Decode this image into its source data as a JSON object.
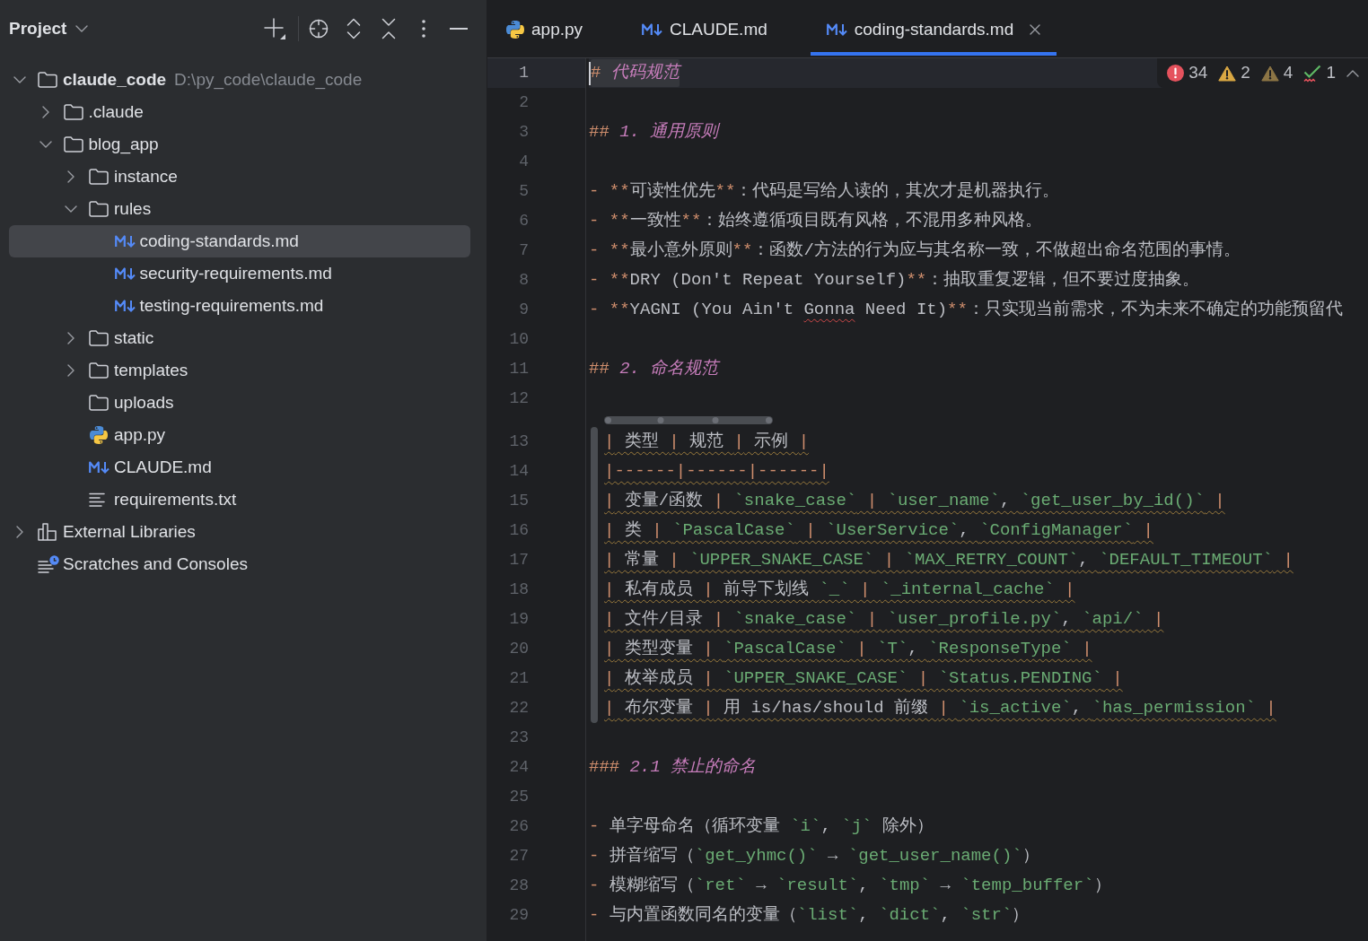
{
  "project_panel": {
    "title": "Project",
    "tree": [
      {
        "label": "claude_code",
        "kind": "folder",
        "path": "D:\\py_code\\claude_code",
        "expanded": true,
        "selected": false,
        "children": [
          {
            "label": ".claude",
            "kind": "folder",
            "expanded": false,
            "selected": false
          },
          {
            "label": "blog_app",
            "kind": "folder",
            "expanded": true,
            "selected": false,
            "children": [
              {
                "label": "instance",
                "kind": "folder",
                "expanded": false,
                "selected": false
              },
              {
                "label": "rules",
                "kind": "folder",
                "expanded": true,
                "selected": false,
                "children": [
                  {
                    "label": "coding-standards.md",
                    "kind": "markdown",
                    "selected": true
                  },
                  {
                    "label": "security-requirements.md",
                    "kind": "markdown",
                    "selected": false
                  },
                  {
                    "label": "testing-requirements.md",
                    "kind": "markdown",
                    "selected": false
                  }
                ]
              },
              {
                "label": "static",
                "kind": "folder",
                "expanded": false,
                "selected": false
              },
              {
                "label": "templates",
                "kind": "folder",
                "expanded": false,
                "selected": false
              },
              {
                "label": "uploads",
                "kind": "folder",
                "selected": false
              },
              {
                "label": "app.py",
                "kind": "python",
                "selected": false
              },
              {
                "label": "CLAUDE.md",
                "kind": "markdown",
                "selected": false
              },
              {
                "label": "requirements.txt",
                "kind": "text",
                "selected": false
              }
            ]
          }
        ]
      },
      {
        "label": "External Libraries",
        "kind": "libraries",
        "expanded": false,
        "selected": false
      },
      {
        "label": "Scratches and Consoles",
        "kind": "scratches",
        "selected": false
      }
    ]
  },
  "editor_tabs": [
    {
      "label": "app.py",
      "kind": "python",
      "selected": false
    },
    {
      "label": "CLAUDE.md",
      "kind": "markdown",
      "selected": false
    },
    {
      "label": "coding-standards.md",
      "kind": "markdown",
      "selected": true
    }
  ],
  "inspections": [
    {
      "kind": "error",
      "count": "34"
    },
    {
      "kind": "warning",
      "count": "2"
    },
    {
      "kind": "weak_warning",
      "count": "4"
    },
    {
      "kind": "typo",
      "count": "1"
    }
  ],
  "editor": {
    "lines": [
      {
        "number": "1",
        "kind": "text",
        "current": true,
        "tokens": [
          {
            "kind": "marker",
            "text": "#"
          },
          {
            "kind": "heading",
            "text": " 代码规范"
          }
        ]
      },
      {
        "number": "2",
        "kind": "text",
        "current": false
      },
      {
        "number": "3",
        "kind": "text",
        "current": false,
        "tokens": [
          {
            "kind": "marker",
            "text": "##"
          },
          {
            "kind": "heading",
            "text": " 1. 通用原则"
          }
        ]
      },
      {
        "number": "4",
        "kind": "text",
        "current": false
      },
      {
        "number": "5",
        "kind": "text",
        "current": false,
        "tokens": [
          {
            "kind": "marker",
            "text": "- **"
          },
          {
            "kind": "text",
            "text": "可读性优先"
          },
          {
            "kind": "marker",
            "text": "**"
          },
          {
            "kind": "text",
            "text": "：代码是写给人读的，其次才是机器执行。"
          }
        ]
      },
      {
        "number": "6",
        "kind": "text",
        "current": false,
        "tokens": [
          {
            "kind": "marker",
            "text": "- **"
          },
          {
            "kind": "text",
            "text": "一致性"
          },
          {
            "kind": "marker",
            "text": "**"
          },
          {
            "kind": "text",
            "text": "：始终遵循项目既有风格，不混用多种风格。"
          }
        ]
      },
      {
        "number": "7",
        "kind": "text",
        "current": false,
        "tokens": [
          {
            "kind": "marker",
            "text": "- **"
          },
          {
            "kind": "text",
            "text": "最小意外原则"
          },
          {
            "kind": "marker",
            "text": "**"
          },
          {
            "kind": "text",
            "text": "：函数/方法的行为应与其名称一致，不做超出命名范围的事情。"
          }
        ]
      },
      {
        "number": "8",
        "kind": "text",
        "current": false,
        "tokens": [
          {
            "kind": "marker",
            "text": "- **"
          },
          {
            "kind": "text",
            "text": "DRY (Don't Repeat Yourself)"
          },
          {
            "kind": "marker",
            "text": "**"
          },
          {
            "kind": "text",
            "text": "：抽取重复逻辑，但不要过度抽象。"
          }
        ]
      },
      {
        "number": "9",
        "kind": "text",
        "current": false,
        "tokens": [
          {
            "kind": "marker",
            "text": "- **"
          },
          {
            "kind": "text",
            "text": "YAGNI (You Ain't "
          },
          {
            "kind": "misspelled",
            "text": "Gonna"
          },
          {
            "kind": "text",
            "text": " Need It)"
          },
          {
            "kind": "marker",
            "text": "**"
          },
          {
            "kind": "text",
            "text": "：只实现当前需求，不为未来不确定的功能预留代"
          }
        ]
      },
      {
        "number": "10",
        "kind": "text",
        "current": false
      },
      {
        "number": "11",
        "kind": "text",
        "current": false,
        "tokens": [
          {
            "kind": "marker",
            "text": "##"
          },
          {
            "kind": "heading",
            "text": " 2. 命名规范"
          }
        ]
      },
      {
        "number": "12",
        "kind": "text",
        "current": false
      },
      {
        "number": "13",
        "kind": "table",
        "current": false,
        "tokens": [
          {
            "kind": "marker",
            "text": "|"
          },
          {
            "kind": "text",
            "text": " 类型 "
          },
          {
            "kind": "marker",
            "text": "|"
          },
          {
            "kind": "text",
            "text": " 规范 "
          },
          {
            "kind": "marker",
            "text": "|"
          },
          {
            "kind": "text",
            "text": " 示例 "
          },
          {
            "kind": "marker",
            "text": "|"
          }
        ]
      },
      {
        "number": "14",
        "kind": "table",
        "current": false,
        "tokens": [
          {
            "kind": "marker",
            "text": "|------|------|------|"
          }
        ]
      },
      {
        "number": "15",
        "kind": "table",
        "current": false,
        "tokens": [
          {
            "kind": "marker",
            "text": "|"
          },
          {
            "kind": "text",
            "text": " 变量/函数 "
          },
          {
            "kind": "marker",
            "text": "| "
          },
          {
            "kind": "code",
            "text": "`snake_case`"
          },
          {
            "kind": "marker",
            "text": " | "
          },
          {
            "kind": "code",
            "text": "`user_name`"
          },
          {
            "kind": "text",
            "text": ", "
          },
          {
            "kind": "code",
            "text": "`get_user_by_id()`"
          },
          {
            "kind": "marker",
            "text": " |"
          }
        ]
      },
      {
        "number": "16",
        "kind": "table",
        "current": false,
        "tokens": [
          {
            "kind": "marker",
            "text": "|"
          },
          {
            "kind": "text",
            "text": " 类 "
          },
          {
            "kind": "marker",
            "text": "| "
          },
          {
            "kind": "code",
            "text": "`PascalCase`"
          },
          {
            "kind": "marker",
            "text": " | "
          },
          {
            "kind": "code",
            "text": "`UserService`"
          },
          {
            "kind": "text",
            "text": ", "
          },
          {
            "kind": "code",
            "text": "`ConfigManager`"
          },
          {
            "kind": "marker",
            "text": " |"
          }
        ]
      },
      {
        "number": "17",
        "kind": "table",
        "current": false,
        "tokens": [
          {
            "kind": "marker",
            "text": "|"
          },
          {
            "kind": "text",
            "text": " 常量 "
          },
          {
            "kind": "marker",
            "text": "| "
          },
          {
            "kind": "code",
            "text": "`UPPER_SNAKE_CASE`"
          },
          {
            "kind": "marker",
            "text": " | "
          },
          {
            "kind": "code",
            "text": "`MAX_RETRY_COUNT`"
          },
          {
            "kind": "text",
            "text": ", "
          },
          {
            "kind": "code",
            "text": "`DEFAULT_TIMEOUT`"
          },
          {
            "kind": "marker",
            "text": " |"
          }
        ]
      },
      {
        "number": "18",
        "kind": "table",
        "current": false,
        "tokens": [
          {
            "kind": "marker",
            "text": "|"
          },
          {
            "kind": "text",
            "text": " 私有成员 "
          },
          {
            "kind": "marker",
            "text": "|"
          },
          {
            "kind": "text",
            "text": " 前导下划线 "
          },
          {
            "kind": "code",
            "text": "`_`"
          },
          {
            "kind": "marker",
            "text": " | "
          },
          {
            "kind": "code",
            "text": "`_internal_cache`"
          },
          {
            "kind": "marker",
            "text": " |"
          }
        ]
      },
      {
        "number": "19",
        "kind": "table",
        "current": false,
        "tokens": [
          {
            "kind": "marker",
            "text": "|"
          },
          {
            "kind": "text",
            "text": " 文件/目录 "
          },
          {
            "kind": "marker",
            "text": "| "
          },
          {
            "kind": "code",
            "text": "`snake_case`"
          },
          {
            "kind": "marker",
            "text": " | "
          },
          {
            "kind": "code",
            "text": "`user_profile.py`"
          },
          {
            "kind": "text",
            "text": ", "
          },
          {
            "kind": "code",
            "text": "`api/`"
          },
          {
            "kind": "marker",
            "text": " |"
          }
        ]
      },
      {
        "number": "20",
        "kind": "table",
        "current": false,
        "tokens": [
          {
            "kind": "marker",
            "text": "|"
          },
          {
            "kind": "text",
            "text": " 类型变量 "
          },
          {
            "kind": "marker",
            "text": "| "
          },
          {
            "kind": "code",
            "text": "`PascalCase`"
          },
          {
            "kind": "marker",
            "text": " | "
          },
          {
            "kind": "code",
            "text": "`T`"
          },
          {
            "kind": "text",
            "text": ", "
          },
          {
            "kind": "code",
            "text": "`ResponseType`"
          },
          {
            "kind": "marker",
            "text": " |"
          }
        ]
      },
      {
        "number": "21",
        "kind": "table",
        "current": false,
        "tokens": [
          {
            "kind": "marker",
            "text": "|"
          },
          {
            "kind": "text",
            "text": " 枚举成员 "
          },
          {
            "kind": "marker",
            "text": "| "
          },
          {
            "kind": "code",
            "text": "`UPPER_SNAKE_CASE`"
          },
          {
            "kind": "marker",
            "text": " | "
          },
          {
            "kind": "code",
            "text": "`Status.PENDING`"
          },
          {
            "kind": "marker",
            "text": " |"
          }
        ]
      },
      {
        "number": "22",
        "kind": "table",
        "current": false,
        "tokens": [
          {
            "kind": "marker",
            "text": "|"
          },
          {
            "kind": "text",
            "text": " 布尔变量 "
          },
          {
            "kind": "marker",
            "text": "|"
          },
          {
            "kind": "text",
            "text": " 用 is/has/should 前缀 "
          },
          {
            "kind": "marker",
            "text": "| "
          },
          {
            "kind": "code",
            "text": "`is_active`"
          },
          {
            "kind": "text",
            "text": ", "
          },
          {
            "kind": "code",
            "text": "`has_permission`"
          },
          {
            "kind": "marker",
            "text": " |"
          }
        ]
      },
      {
        "number": "23",
        "kind": "text",
        "current": false
      },
      {
        "number": "24",
        "kind": "text",
        "current": false,
        "tokens": [
          {
            "kind": "marker",
            "text": "###"
          },
          {
            "kind": "heading",
            "text": " 2.1 禁止的命名"
          }
        ]
      },
      {
        "number": "25",
        "kind": "text",
        "current": false
      },
      {
        "number": "26",
        "kind": "text",
        "current": false,
        "tokens": [
          {
            "kind": "marker",
            "text": "- "
          },
          {
            "kind": "text",
            "text": "单字母命名（循环变量 "
          },
          {
            "kind": "code",
            "text": "`i`"
          },
          {
            "kind": "text",
            "text": ", "
          },
          {
            "kind": "code",
            "text": "`j`"
          },
          {
            "kind": "text",
            "text": " 除外）"
          }
        ]
      },
      {
        "number": "27",
        "kind": "text",
        "current": false,
        "tokens": [
          {
            "kind": "marker",
            "text": "- "
          },
          {
            "kind": "text",
            "text": "拼音缩写（"
          },
          {
            "kind": "code",
            "text": "`get_yhmc()`"
          },
          {
            "kind": "text",
            "text": " → "
          },
          {
            "kind": "code",
            "text": "`get_user_name()`"
          },
          {
            "kind": "text",
            "text": "）"
          }
        ]
      },
      {
        "number": "28",
        "kind": "text",
        "current": false,
        "tokens": [
          {
            "kind": "marker",
            "text": "- "
          },
          {
            "kind": "text",
            "text": "模糊缩写（"
          },
          {
            "kind": "code",
            "text": "`ret`"
          },
          {
            "kind": "text",
            "text": " → "
          },
          {
            "kind": "code",
            "text": "`result`"
          },
          {
            "kind": "text",
            "text": ", "
          },
          {
            "kind": "code",
            "text": "`tmp`"
          },
          {
            "kind": "text",
            "text": " → "
          },
          {
            "kind": "code",
            "text": "`temp_buffer`"
          },
          {
            "kind": "text",
            "text": "）"
          }
        ]
      },
      {
        "number": "29",
        "kind": "text",
        "current": false,
        "tokens": [
          {
            "kind": "marker",
            "text": "- "
          },
          {
            "kind": "text",
            "text": "与内置函数同名的变量（"
          },
          {
            "kind": "code",
            "text": "`list`"
          },
          {
            "kind": "text",
            "text": ", "
          },
          {
            "kind": "code",
            "text": "`dict`"
          },
          {
            "kind": "text",
            "text": ", "
          },
          {
            "kind": "code",
            "text": "`str`"
          },
          {
            "kind": "text",
            "text": "）"
          }
        ]
      }
    ]
  }
}
